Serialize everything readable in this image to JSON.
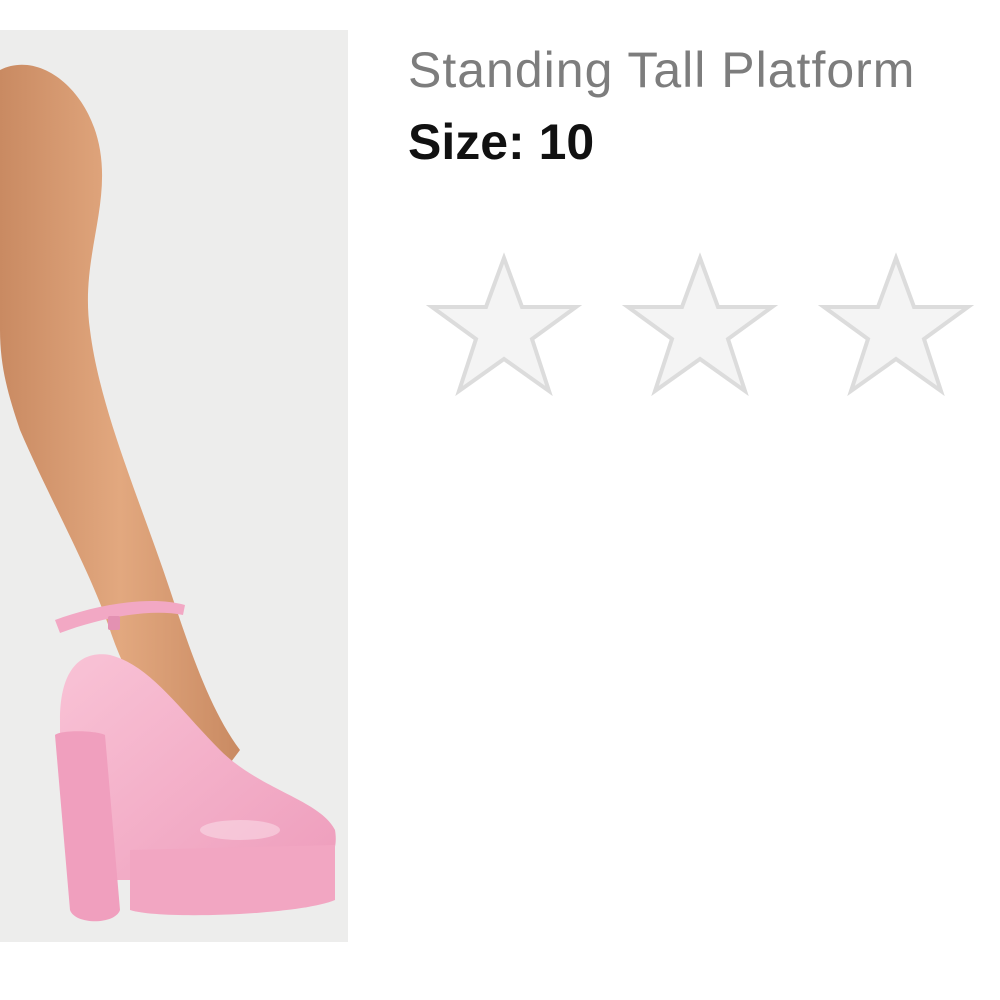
{
  "product": {
    "title": "Standing Tall Platform",
    "size_label": "Size:",
    "size_value": "10",
    "size_text": "Size: 10",
    "image_icon": "pink-platform-heel-photo",
    "colors": {
      "title": "#7d7d7d",
      "size": "#111111",
      "shoe": "#f4a9c4",
      "star_fill": "#f4f4f4",
      "star_stroke": "#dcdcdc"
    }
  },
  "rating": {
    "max_stars": 3,
    "filled_stars": 0,
    "star_icon": "star-outline-icon"
  }
}
